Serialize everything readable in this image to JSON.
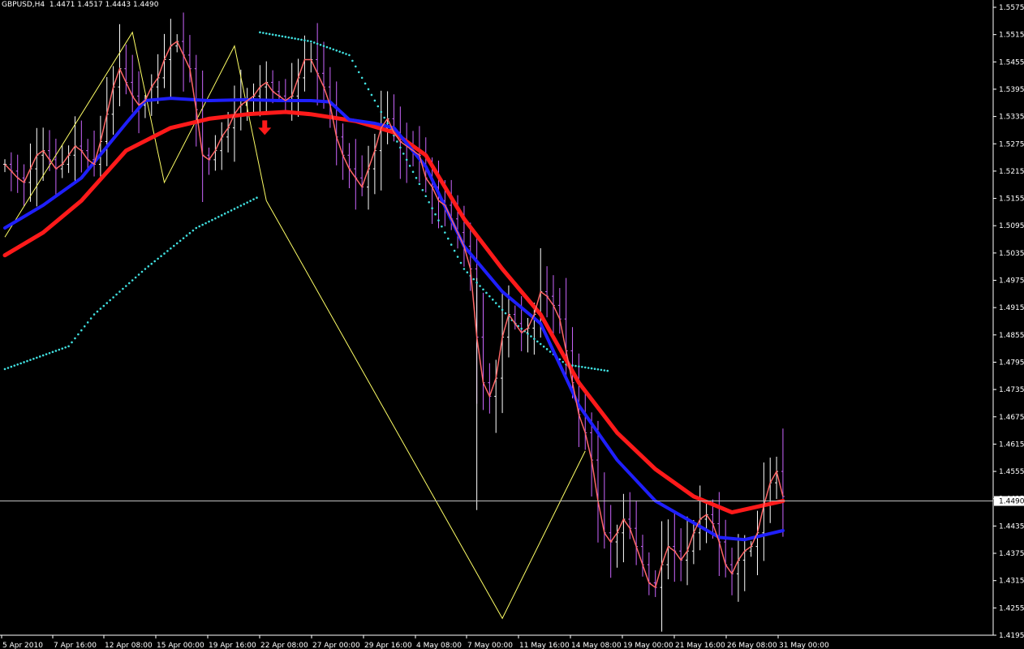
{
  "header": {
    "symbol": "GBPUSD,H4",
    "ohlc": "1.4471 1.4517 1.4443 1.4490"
  },
  "colors": {
    "background": "#000000",
    "axis": "#ffffff",
    "bull_bar": "#ffffff",
    "bear_bar": "#cc66ff",
    "price_line": "#ff6666",
    "ma_fast": "#1f1fff",
    "ma_slow": "#ff1a1a",
    "envelope": "#40e0e0",
    "zigzag": "#ffff66",
    "arrow": "#ff1a1a",
    "current_price": "#c0c0c0"
  },
  "chart_data": {
    "type": "line",
    "title": "GBPUSD,H4",
    "ylim": [
      1.4195,
      1.5575
    ],
    "y_ticks": [
      "1.5575",
      "1.5515",
      "1.5455",
      "1.5395",
      "1.5335",
      "1.5275",
      "1.5215",
      "1.5155",
      "1.5095",
      "1.5035",
      "1.4975",
      "1.4915",
      "1.4855",
      "1.4795",
      "1.4735",
      "1.4675",
      "1.4615",
      "1.4555",
      "1.4495",
      "1.4435",
      "1.4375",
      "1.4315",
      "1.4255",
      "1.4195"
    ],
    "x_ticks": [
      "5 Apr 2010",
      "7 Apr 16:00",
      "12 Apr 08:00",
      "15 Apr 00:00",
      "19 Apr 16:00",
      "22 Apr 08:00",
      "27 Apr 00:00",
      "29 Apr 16:00",
      "4 May 08:00",
      "7 May 00:00",
      "11 May 16:00",
      "14 May 08:00",
      "19 May 00:00",
      "21 May 16:00",
      "26 May 08:00",
      "31 May 00:00"
    ],
    "current_price": "1.4490",
    "grid": false,
    "bar_count": 123,
    "series": [
      {
        "kind": "price",
        "values": [
          1.523,
          1.5215,
          1.52,
          1.519,
          1.522,
          1.525,
          1.526,
          1.524,
          1.522,
          1.523,
          1.525,
          1.527,
          1.526,
          1.524,
          1.523,
          1.528,
          1.534,
          1.54,
          1.544,
          1.541,
          1.538,
          1.536,
          1.537,
          1.54,
          1.542,
          1.546,
          1.549,
          1.55,
          1.547,
          1.544,
          1.535,
          1.525,
          1.524,
          1.526,
          1.529,
          1.531,
          1.534,
          1.536,
          1.537,
          1.538,
          1.54,
          1.541,
          1.539,
          1.538,
          1.537,
          1.538,
          1.542,
          1.546,
          1.546,
          1.543,
          1.54,
          1.536,
          1.529,
          1.525,
          1.522,
          1.52,
          1.518,
          1.522,
          1.526,
          1.531,
          1.533,
          1.53,
          1.528,
          1.527,
          1.526,
          1.525,
          1.52,
          1.518,
          1.515,
          1.514,
          1.511,
          1.508,
          1.505,
          1.5,
          1.485,
          1.475,
          1.472,
          1.476,
          1.485,
          1.49,
          1.488,
          1.486,
          1.487,
          1.49,
          1.495,
          1.494,
          1.492,
          1.489,
          1.482,
          1.475,
          1.468,
          1.464,
          1.458,
          1.449,
          1.442,
          1.44,
          1.442,
          1.445,
          1.443,
          1.439,
          1.435,
          1.431,
          1.43,
          1.435,
          1.439,
          1.438,
          1.436,
          1.438,
          1.442,
          1.445,
          1.446,
          1.444,
          1.44,
          1.435,
          1.433,
          1.436,
          1.438,
          1.439,
          1.442,
          1.448,
          1.453,
          1.4555,
          1.45
        ]
      },
      {
        "kind": "ma_fast",
        "points": [
          [
            0,
            1.509
          ],
          [
            6,
            1.514
          ],
          [
            12,
            1.52
          ],
          [
            19,
            1.532
          ],
          [
            22,
            1.537
          ],
          [
            26,
            1.5375
          ],
          [
            32,
            1.537
          ],
          [
            38,
            1.5372
          ],
          [
            43,
            1.537
          ],
          [
            48,
            1.537
          ],
          [
            51,
            1.5367
          ],
          [
            54,
            1.5328
          ],
          [
            58,
            1.532
          ],
          [
            61,
            1.531
          ],
          [
            66,
            1.5225
          ],
          [
            72,
            1.505
          ],
          [
            78,
            1.495
          ],
          [
            84,
            1.488
          ],
          [
            90,
            1.47
          ],
          [
            96,
            1.458
          ],
          [
            102,
            1.449
          ],
          [
            107,
            1.445
          ],
          [
            112,
            1.441
          ],
          [
            116,
            1.4405
          ],
          [
            122,
            1.4425
          ]
        ]
      },
      {
        "kind": "ma_slow",
        "points": [
          [
            0,
            1.503
          ],
          [
            6,
            1.508
          ],
          [
            12,
            1.515
          ],
          [
            19,
            1.526
          ],
          [
            26,
            1.531
          ],
          [
            32,
            1.533
          ],
          [
            38,
            1.534
          ],
          [
            44,
            1.5345
          ],
          [
            48,
            1.534
          ],
          [
            55,
            1.5325
          ],
          [
            61,
            1.53
          ],
          [
            66,
            1.525
          ],
          [
            72,
            1.511
          ],
          [
            78,
            1.5
          ],
          [
            84,
            1.49
          ],
          [
            90,
            1.475
          ],
          [
            96,
            1.464
          ],
          [
            102,
            1.456
          ],
          [
            108,
            1.45
          ],
          [
            114,
            1.4465
          ],
          [
            122,
            1.449
          ]
        ]
      },
      {
        "kind": "envelope_lower",
        "points": [
          [
            0,
            1.478
          ],
          [
            10,
            1.483
          ],
          [
            14,
            1.49
          ],
          [
            22,
            1.5
          ],
          [
            30,
            1.509
          ],
          [
            40,
            1.516
          ]
        ]
      },
      {
        "kind": "envelope_upper",
        "points": [
          [
            40,
            1.552
          ],
          [
            48,
            1.55
          ],
          [
            54,
            1.547
          ],
          [
            60,
            1.532
          ],
          [
            66,
            1.516
          ],
          [
            72,
            1.5
          ],
          [
            80,
            1.488
          ],
          [
            88,
            1.479
          ],
          [
            95,
            1.4775
          ]
        ]
      },
      {
        "kind": "zigzag",
        "points": [
          [
            0,
            1.507
          ],
          [
            20,
            1.552
          ],
          [
            25,
            1.519
          ],
          [
            36,
            1.549
          ],
          [
            41,
            1.515
          ],
          [
            78,
            1.4232
          ],
          [
            91,
            1.46
          ]
        ]
      }
    ],
    "signal": {
      "type": "down-arrow",
      "bar": 41,
      "price": 1.5305
    }
  }
}
